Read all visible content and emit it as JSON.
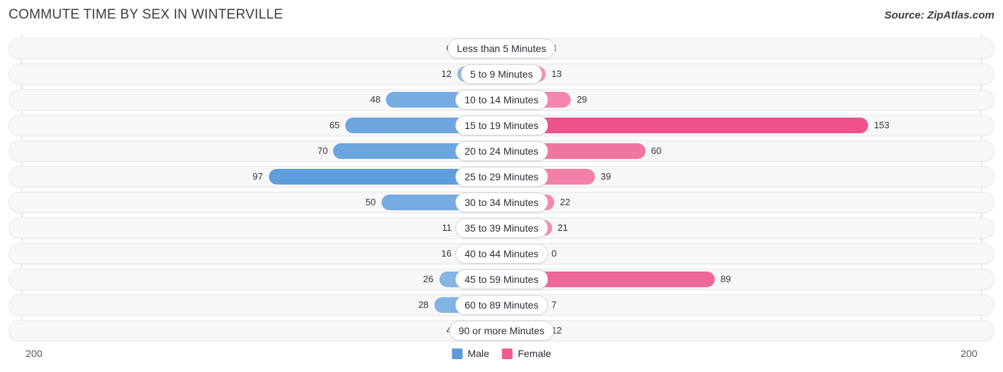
{
  "header": {
    "title": "COMMUTE TIME BY SEX IN WINTERVILLE",
    "source": "Source: ZipAtlas.com"
  },
  "footer": {
    "axis_left_max": "200",
    "axis_right_max": "200"
  },
  "legend": {
    "items": [
      {
        "label": "Male",
        "color": "#5b9bd5"
      },
      {
        "label": "Female",
        "color": "#ef5d93"
      }
    ]
  },
  "chart_data": {
    "type": "bar",
    "subtype": "diverging-bidirectional",
    "title": "COMMUTE TIME BY SEX IN WINTERVILLE",
    "xlabel": "",
    "ylabel": "",
    "xlim": [
      200,
      200
    ],
    "grid": false,
    "legend_position": "bottom-center",
    "categories": [
      "Less than 5 Minutes",
      "5 to 9 Minutes",
      "10 to 14 Minutes",
      "15 to 19 Minutes",
      "20 to 24 Minutes",
      "25 to 29 Minutes",
      "30 to 34 Minutes",
      "35 to 39 Minutes",
      "40 to 44 Minutes",
      "45 to 59 Minutes",
      "60 to 89 Minutes",
      "90 or more Minutes"
    ],
    "series": [
      {
        "name": "Male",
        "direction": "left",
        "color": "#5b9bd5",
        "values": [
          0,
          12,
          48,
          65,
          70,
          97,
          50,
          11,
          16,
          26,
          28,
          4
        ]
      },
      {
        "name": "Female",
        "direction": "right",
        "color": "#ef5d93",
        "values": [
          4,
          13,
          29,
          153,
          60,
          39,
          22,
          21,
          0,
          89,
          7,
          12
        ]
      }
    ]
  }
}
